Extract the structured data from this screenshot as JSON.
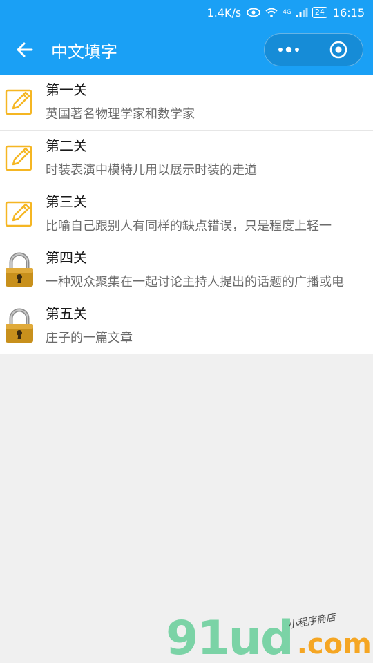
{
  "status": {
    "speed": "1.4K/s",
    "net": "4G",
    "battery": "24",
    "time": "16:15"
  },
  "nav": {
    "title": "中文填字",
    "back_icon": "arrow-left-icon",
    "menu_icon": "more-dots-icon",
    "close_icon": "target-circle-icon"
  },
  "levels": [
    {
      "title": "第一关",
      "desc": "英国著名物理学家和数学家",
      "icon": "pencil-note-icon"
    },
    {
      "title": "第二关",
      "desc": "时装表演中模特儿用以展示时装的走道",
      "icon": "pencil-note-icon"
    },
    {
      "title": "第三关",
      "desc": "比喻自己跟别人有同样的缺点错误，只是程度上轻一",
      "icon": "pencil-note-icon"
    },
    {
      "title": "第四关",
      "desc": "一种观众聚集在一起讨论主持人提出的话题的广播或电",
      "icon": "lock-icon"
    },
    {
      "title": "第五关",
      "desc": "庄子的一篇文章",
      "icon": "lock-icon"
    }
  ],
  "watermark": {
    "main": "91ud",
    "domain": ".com",
    "sub": "小程序商店"
  },
  "colors": {
    "accent": "#1aa0f5",
    "pencil": "#f5b623",
    "lock": "#c8901c"
  }
}
